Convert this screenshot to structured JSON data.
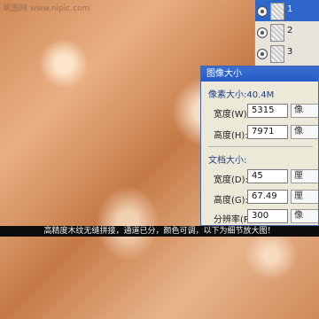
{
  "watermark": "昵图网 www.nipic.com",
  "caption": "高精度木纹无缝拼接，通道已分，颜色可调，以下为细节放大图！",
  "layers": [
    {
      "label": "1",
      "selected": true
    },
    {
      "label": "2",
      "selected": false
    },
    {
      "label": "3",
      "selected": false
    }
  ],
  "dialog": {
    "title": "图像大小",
    "pixel_group": "像素大小:40.4M",
    "pixel_rows": [
      {
        "label": "宽度(W):",
        "value": "5315",
        "unit": "像"
      },
      {
        "label": "高度(H):",
        "value": "7971",
        "unit": "像"
      }
    ],
    "doc_group": "文档大小:",
    "doc_rows": [
      {
        "label": "宽度(D):",
        "value": "45",
        "unit": "厘"
      },
      {
        "label": "高度(G):",
        "value": "67.49",
        "unit": "厘"
      },
      {
        "label": "分辨率(R):",
        "value": "300",
        "unit": "像"
      }
    ]
  }
}
